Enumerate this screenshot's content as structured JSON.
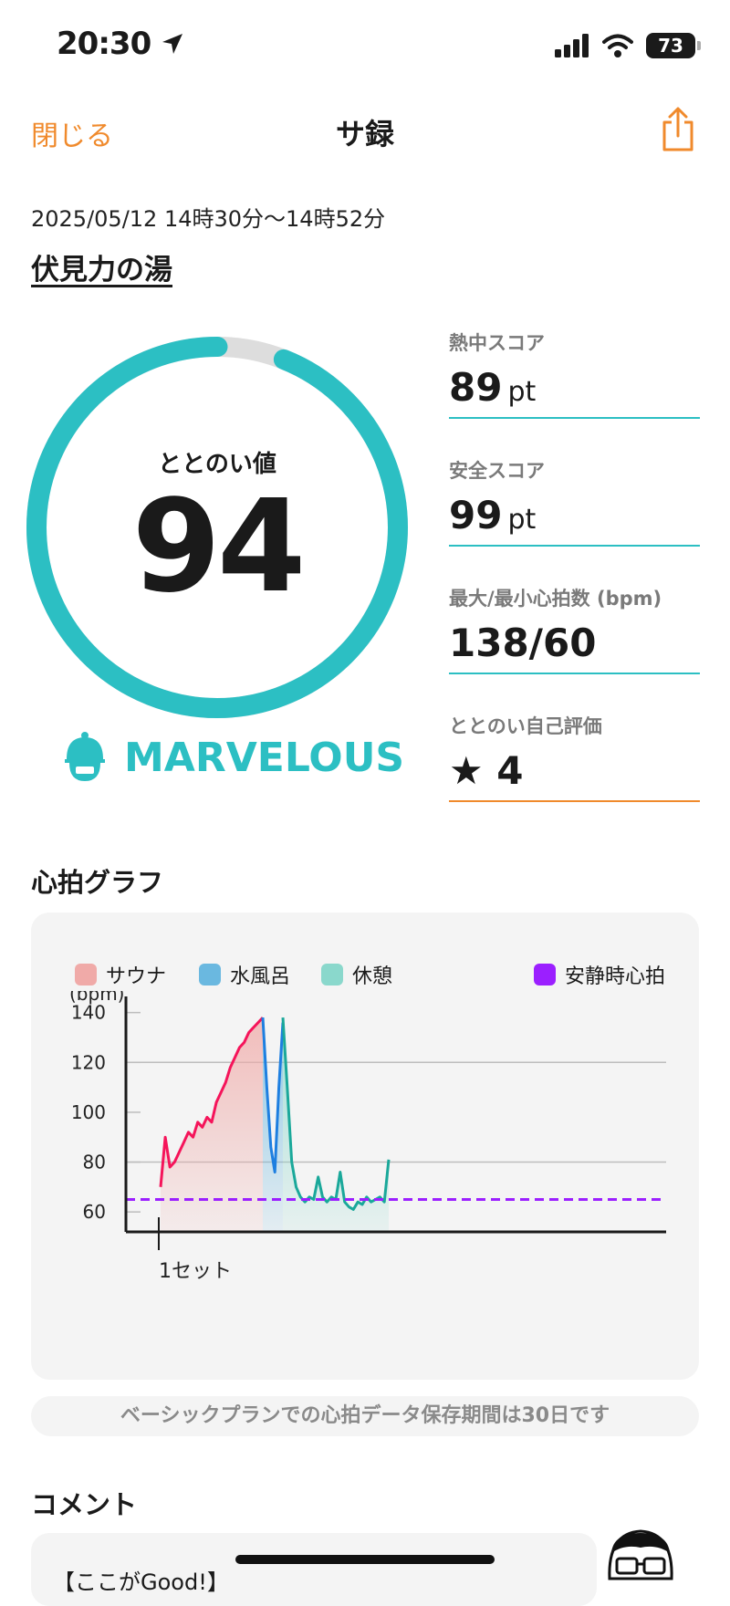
{
  "status_bar": {
    "time": "20:30",
    "battery": "73"
  },
  "nav": {
    "close_label": "閉じる",
    "title": "サ録",
    "share_icon": "share-icon"
  },
  "session": {
    "datetime": "2025/05/12 14時30分〜14時52分",
    "facility": "伏見力の湯"
  },
  "totonoi": {
    "label": "ととのい値",
    "value": "94",
    "progress": 0.94,
    "grade": "MARVELOUS"
  },
  "scores": [
    {
      "label": "熱中スコア",
      "value": "89",
      "unit": "pt"
    },
    {
      "label": "安全スコア",
      "value": "99",
      "unit": "pt"
    },
    {
      "label": "最大/最小心拍数 (bpm)",
      "value": "138/60",
      "unit": ""
    },
    {
      "label": "ととのい自己評価",
      "value": "★ 4",
      "unit": ""
    }
  ],
  "colors": {
    "accent": "#2cbfc3",
    "orange": "#f08a2c",
    "sauna": "#f0aaa8",
    "cold": "#6ab8e0",
    "rest": "#8ad8cc",
    "resting_hr": "#9b1fff"
  },
  "graph": {
    "title": "心拍グラフ",
    "legend": {
      "sauna": "サウナ",
      "cold": "水風呂",
      "rest": "休憩",
      "resting": "安静時心拍"
    },
    "set_label": "1セット",
    "notice": "ベーシックプランでの心拍データ保存期間は30日です"
  },
  "chart_data": {
    "type": "line",
    "ylabel": "(bpm)",
    "yticks": [
      60,
      80,
      100,
      120,
      140
    ],
    "ylim": [
      52,
      145
    ],
    "x_categories": [
      "1セット"
    ],
    "resting_hr": 65,
    "series": [
      {
        "name": "サウナ",
        "color": "#f5145a",
        "values": [
          70,
          90,
          78,
          80,
          84,
          88,
          92,
          90,
          96,
          94,
          98,
          96,
          104,
          108,
          112,
          118,
          122,
          126,
          128,
          132,
          134,
          136,
          138
        ]
      },
      {
        "name": "水風呂",
        "color": "#1e7fe0",
        "values": [
          138,
          110,
          86,
          76,
          110,
          136
        ]
      },
      {
        "name": "休憩",
        "color": "#1aa89a",
        "values": [
          138,
          110,
          80,
          70,
          66,
          64,
          66,
          65,
          74,
          66,
          64,
          66,
          65,
          76,
          64,
          62,
          61,
          64,
          63,
          66,
          64,
          65,
          66,
          64,
          81
        ]
      }
    ]
  },
  "comment": {
    "title": "コメント",
    "text": "【ここがGood!】"
  }
}
